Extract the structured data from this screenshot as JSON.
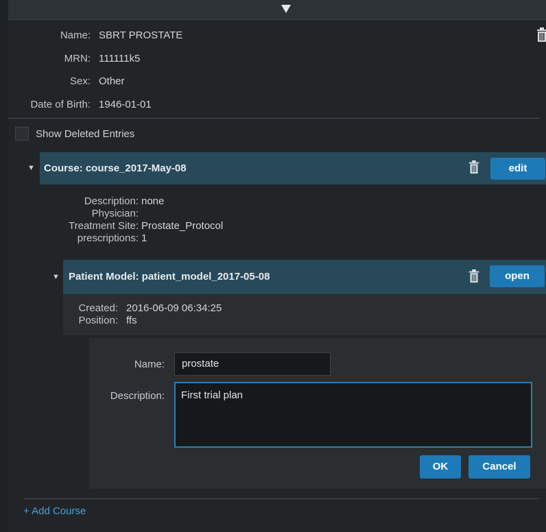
{
  "patient": {
    "name_label": "Name:",
    "name": "SBRT PROSTATE",
    "mrn_label": "MRN:",
    "mrn": "111111k5",
    "sex_label": "Sex:",
    "sex": "Other",
    "dob_label": "Date of Birth:",
    "dob": "1946-01-01"
  },
  "show_deleted": {
    "label": "Show Deleted Entries",
    "checked": false
  },
  "course": {
    "title": "Course: course_2017-May-08",
    "edit_label": "edit",
    "description_label": "Description:",
    "description": "none",
    "physician_label": "Physician:",
    "physician": "",
    "treatment_site_label": "Treatment Site:",
    "treatment_site": "Prostate_Protocol",
    "prescriptions_label": "prescriptions:",
    "prescriptions": "1"
  },
  "patient_model": {
    "title": "Patient Model: patient_model_2017-05-08",
    "open_label": "open",
    "created_label": "Created:",
    "created": "2016-06-09 06:34:25",
    "position_label": "Position:",
    "position": "ffs"
  },
  "plan_form": {
    "name_label": "Name:",
    "name_value": "prostate",
    "description_label": "Description:",
    "description_value": "First trial plan",
    "ok_label": "OK",
    "cancel_label": "Cancel"
  },
  "add_course_label": "+ Add Course",
  "colors": {
    "header_bg": "#27495a",
    "button_blue": "#1e7ab6",
    "link_blue": "#4a9fd6"
  }
}
